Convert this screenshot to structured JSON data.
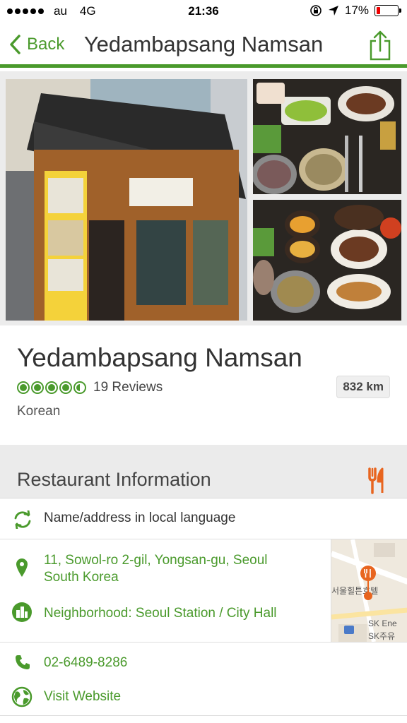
{
  "status_bar": {
    "carrier": "au",
    "network": "4G",
    "time": "21:36",
    "battery": "17%",
    "battery_level": 0.17
  },
  "nav": {
    "back_label": "Back",
    "title": "Yedambapsang Namsan",
    "accent_color": "#4a9a2c"
  },
  "restaurant": {
    "name": "Yedambapsang Namsan",
    "rating": 4.5,
    "rating_max": 5,
    "reviews": "19 Reviews",
    "distance": "832 km",
    "cuisine": "Korean"
  },
  "info": {
    "section_title": "Restaurant Information",
    "local_language_label": "Name/address in local language",
    "address_line1": "11, Sowol-ro 2-gil, Yongsan-gu, Seoul",
    "address_line2": "South Korea",
    "neighborhood": "Neighborhood: Seoul Station / City Hall",
    "phone": "02-6489-8286",
    "website_label": "Visit Website",
    "map_labels": {
      "hotel": "서울힐튼호텔",
      "sk1": "SK Ene",
      "sk2": "SK주유"
    }
  }
}
